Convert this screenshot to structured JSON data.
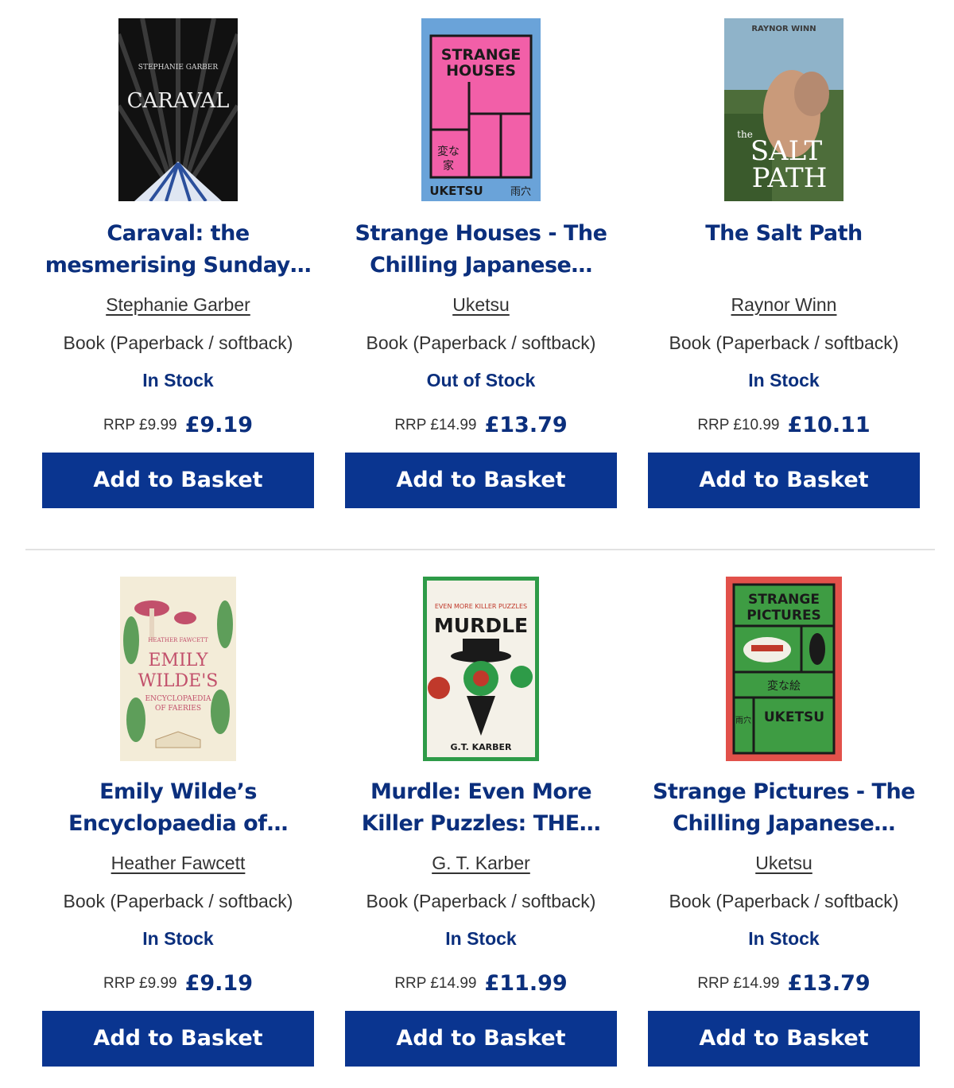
{
  "products": [
    {
      "title": "Caraval: the mesmerising Sunday…",
      "author": "Stephanie Garber",
      "format": "Book (Paperback / softback)",
      "stock": "In Stock",
      "rrp": "RRP £9.99",
      "price": "£9.19",
      "button": "Add to Basket",
      "cover_text": [
        "STEPHANIE GARBER",
        "CARAVAL"
      ],
      "cover_colors": {
        "bg": "#111111",
        "accent": "#d9d9d9"
      }
    },
    {
      "title": "Strange Houses - The Chilling Japanese…",
      "author": "Uketsu",
      "format": "Book (Paperback / softback)",
      "stock": "Out of Stock",
      "rrp": "RRP £14.99",
      "price": "£13.79",
      "button": "Add to Basket",
      "cover_text": [
        "STRANGE",
        "HOUSES",
        "変な",
        "家",
        "UKETSU",
        "雨穴"
      ],
      "cover_colors": {
        "bg": "#6aa3d9",
        "accent": "#f25fa8"
      }
    },
    {
      "title": "The Salt Path",
      "author": "Raynor Winn",
      "format": "Book (Paperback / softback)",
      "stock": "In Stock",
      "rrp": "RRP £10.99",
      "price": "£10.11",
      "button": "Add to Basket",
      "cover_text": [
        "RAYNOR WINN",
        "the",
        "SALT",
        "PATH"
      ],
      "cover_colors": {
        "bg": "#4d6d3a",
        "accent": "#8fb3c9"
      }
    },
    {
      "title": "Emily Wilde’s Encyclopaedia of…",
      "author": "Heather Fawcett",
      "format": "Book (Paperback / softback)",
      "stock": "In Stock",
      "rrp": "RRP £9.99",
      "price": "£9.19",
      "button": "Add to Basket",
      "cover_text": [
        "HEATHER FAWCETT",
        "EMILY",
        "WILDE'S",
        "ENCYCLOPAEDIA",
        "OF FAERIES"
      ],
      "cover_colors": {
        "bg": "#f3ecd8",
        "accent": "#c2506b"
      }
    },
    {
      "title": "Murdle: Even More Killer Puzzles: THE…",
      "author": "G. T. Karber",
      "format": "Book (Paperback / softback)",
      "stock": "In Stock",
      "rrp": "RRP £14.99",
      "price": "£11.99",
      "button": "Add to Basket",
      "cover_text": [
        "EVEN MORE KILLER PUZZLES",
        "MURDLE",
        "G.T. KARBER"
      ],
      "cover_colors": {
        "bg": "#f4f1e8",
        "accent": "#2e9b48"
      }
    },
    {
      "title": "Strange Pictures - The Chilling Japanese…",
      "author": "Uketsu",
      "format": "Book (Paperback / softback)",
      "stock": "In Stock",
      "rrp": "RRP £14.99",
      "price": "£13.79",
      "button": "Add to Basket",
      "cover_text": [
        "STRANGE",
        "PICTURES",
        "変な絵",
        "UKETSU",
        "雨穴"
      ],
      "cover_colors": {
        "bg": "#e2514a",
        "accent": "#3e9c43"
      }
    }
  ]
}
